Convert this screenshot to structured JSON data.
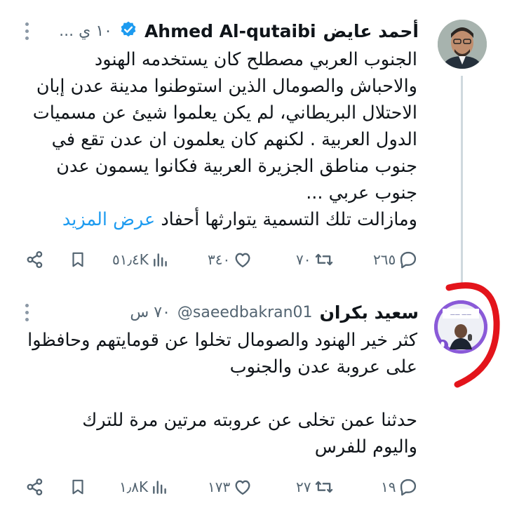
{
  "tweets": [
    {
      "display_name": "أحمد عايض",
      "username": "Ahmed Al-qutaibi",
      "verified": true,
      "time": "... ١٠ ي",
      "lines": [
        "الجنوب العربي مصطلح كان يستخدمه الهنود",
        "والاحباش والصومال الذين استوطنوا مدينة عدن إبان",
        "الاحتلال البريطاني، لم يكن يعلموا شيئ عن مسميات",
        "الدول العربية . لكنهم كان يعلمون ان عدن تقع في",
        "جنوب مناطق الجزيرة العربية فكانوا يسمون عدن",
        "جنوب عربي ...",
        "ومازالت تلك التسمية يتوارثها أحفاد"
      ],
      "show_more": "عرض المزيد",
      "replies": "٢٦٥",
      "retweets": "٧٠",
      "likes": "٣٤٠",
      "views": "٥١٫٤K"
    },
    {
      "display_name": "سعيد بكران",
      "handle": "@saeedbakran01",
      "time": "٧٠ س",
      "lines": [
        "كثر خير الهنود والصومال تخلوا عن قومايتهم وحافظوا",
        "على عروبة عدن والجنوب",
        "",
        "حدثنا عمن تخلى عن عروبته مرتين مرة للترك",
        "واليوم للفرس"
      ],
      "replies": "١٩",
      "retweets": "٢٧",
      "likes": "١٧٣",
      "views": "١٫٨K"
    }
  ],
  "colors": {
    "accent": "#1d9bf0",
    "muted": "#536471",
    "annotation": "#e3141b"
  },
  "icons": [
    "share-icon",
    "bookmark-icon",
    "views-icon",
    "like-icon",
    "retweet-icon",
    "reply-icon",
    "verified-icon",
    "more-icon"
  ]
}
